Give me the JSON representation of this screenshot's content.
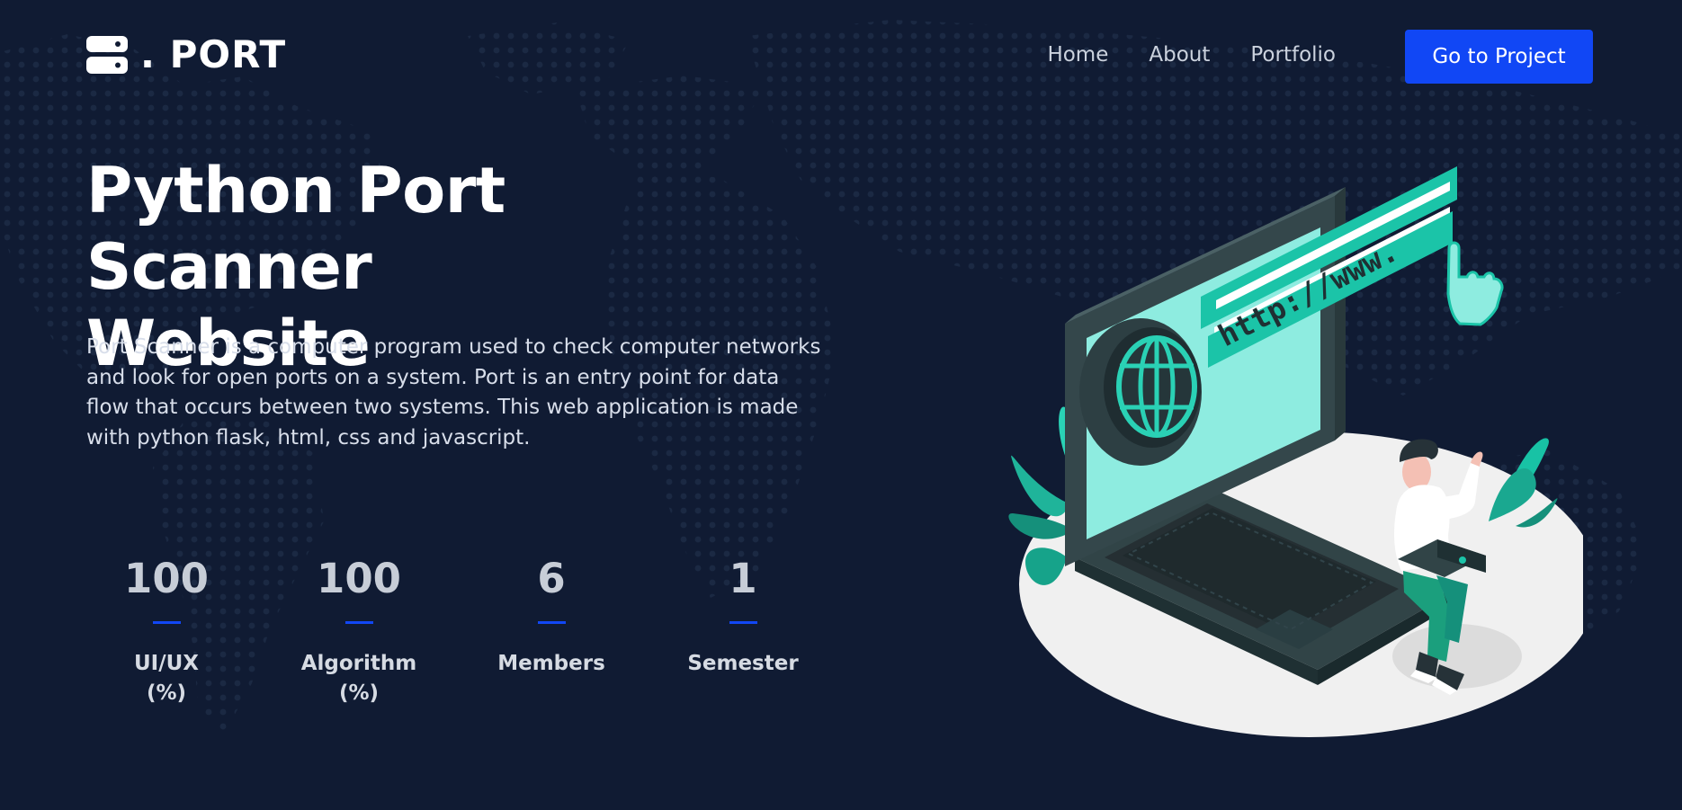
{
  "brand": {
    "name": ". PORT",
    "icon": "server-icon",
    "accent_color": "#1147f5",
    "background_color": "#101b33"
  },
  "navbar": {
    "links": [
      {
        "label": "Home"
      },
      {
        "label": "About"
      },
      {
        "label": "Portfolio"
      }
    ],
    "cta_label": "Go to Project"
  },
  "hero": {
    "title_line1": "Python Port Scanner",
    "title_line2": "Website",
    "description": "Port Scanner is a computer program used to check computer networks and look for open ports on a system. Port is an entry point for data flow that occurs between two systems. This web application is made with python flask, html, css and javascript."
  },
  "stats": [
    {
      "value": "100",
      "label_line1": "UI/UX",
      "label_line2": "(%)"
    },
    {
      "value": "100",
      "label_line1": "Algorithm",
      "label_line2": "(%)"
    },
    {
      "value": "6",
      "label_line1": "Members",
      "label_line2": ""
    },
    {
      "value": "1",
      "label_line1": "Semester",
      "label_line2": ""
    }
  ],
  "illustration": {
    "browser_text": "http://www.",
    "icons": [
      "globe-icon",
      "pointer-hand-icon",
      "laptop-icon"
    ]
  }
}
